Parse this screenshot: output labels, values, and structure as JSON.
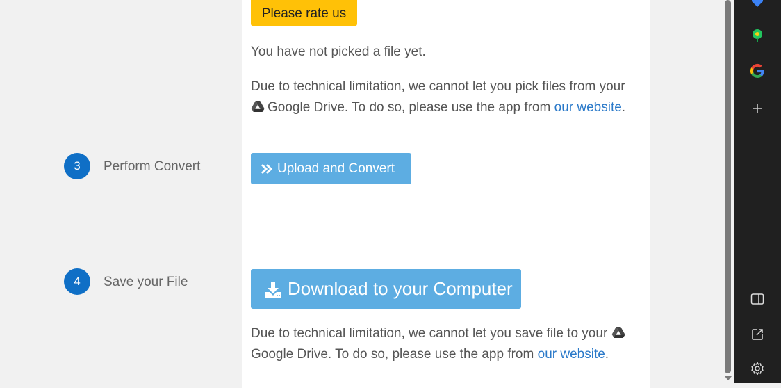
{
  "rate_button": "Please rate us",
  "no_file_text": "You have not picked a file yet.",
  "pick_limitation": {
    "before": "Due to technical limitation, we cannot let you pick files from your",
    "middle": "Google Drive. To do so, please use the app from",
    "link": "our website",
    "end": "."
  },
  "steps": [
    {
      "number": "3",
      "label": "Perform Convert",
      "button": "Upload and Convert",
      "button_icon": "double-chevron-right-icon"
    },
    {
      "number": "4",
      "label": "Save your File",
      "button": "Download to your Computer",
      "button_icon": "download-icon"
    }
  ],
  "save_limitation": {
    "before": "Due to technical limitation, we cannot let you save file to your",
    "middle": "Google Drive. To do so, please use the app from",
    "link": "our website",
    "end": "."
  },
  "sidebar_icons": [
    "tag-icon",
    "tree-icon",
    "google-icon",
    "plus-icon",
    "split-screen-icon",
    "open-external-icon",
    "settings-icon"
  ],
  "colors": {
    "rate": "#ffc107",
    "primary": "#5dade2",
    "step": "#0f6fc6",
    "link": "#2a79c9"
  }
}
